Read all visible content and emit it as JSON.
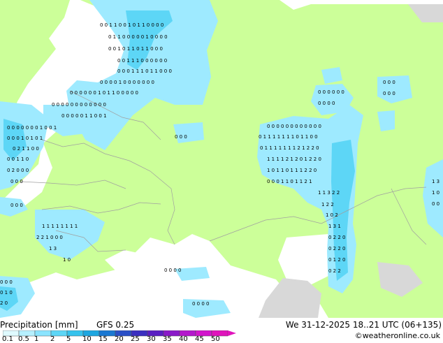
{
  "footer": {
    "title": "Precipitation [mm]",
    "model": "GFS 0.25",
    "valid_time": "We 31-12-2025 18..21 UTC (06+135)",
    "credit": "©weatheronline.co.uk"
  },
  "legend": {
    "ticks": [
      "0.1",
      "0.5",
      "1",
      "2",
      "5",
      "10",
      "15",
      "20",
      "25",
      "30",
      "35",
      "40",
      "45",
      "50"
    ],
    "colors": [
      "#dffaff",
      "#b6f0ff",
      "#8be4ff",
      "#5dd6f6",
      "#36c2ec",
      "#1ea6e0",
      "#1a78d2",
      "#2a4fc6",
      "#3b2fc0",
      "#5a1fc2",
      "#8a19c8",
      "#b417cc",
      "#d215cc",
      "#e014bc"
    ]
  },
  "colors": {
    "land": "#ccff99",
    "sea": "#ffffff",
    "high_ground": "#d8d8d8",
    "precip_light": "#9eeaff",
    "precip_moderate": "#5dd6f6",
    "border": "#a0a0a0"
  }
}
